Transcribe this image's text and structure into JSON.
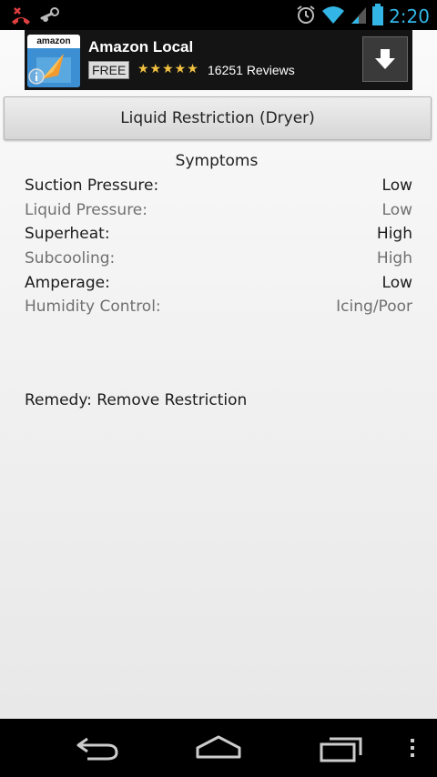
{
  "status_bar": {
    "time": "2:20",
    "notification_icons": [
      "missed-call-icon",
      "steam-icon"
    ],
    "system_icons": [
      "alarm-icon",
      "wifi-icon",
      "signal-icon",
      "battery-icon"
    ],
    "time_color": "#33b5e5"
  },
  "ad": {
    "brand_text": "amazon",
    "title": "Amazon Local",
    "price": "FREE",
    "stars": "★★★★★",
    "rating_stars": 4.5,
    "reviews": "16251 Reviews",
    "star_color": "#f3c241"
  },
  "main": {
    "title_button": "Liquid Restriction (Dryer)",
    "symptoms_heading": "Symptoms",
    "symptoms": [
      {
        "label": "Suction Pressure:",
        "value": "Low"
      },
      {
        "label": "Liquid Pressure:",
        "value": "Low"
      },
      {
        "label": "Superheat:",
        "value": "High"
      },
      {
        "label": "Subcooling:",
        "value": "High"
      },
      {
        "label": "Amperage:",
        "value": "Low"
      },
      {
        "label": "Humidity Control:",
        "value": "Icing/Poor"
      }
    ],
    "remedy": "Remedy: Remove Restriction"
  },
  "nav_bar": {
    "buttons": [
      "back-icon",
      "home-icon",
      "recent-apps-icon",
      "overflow-menu-icon"
    ]
  }
}
